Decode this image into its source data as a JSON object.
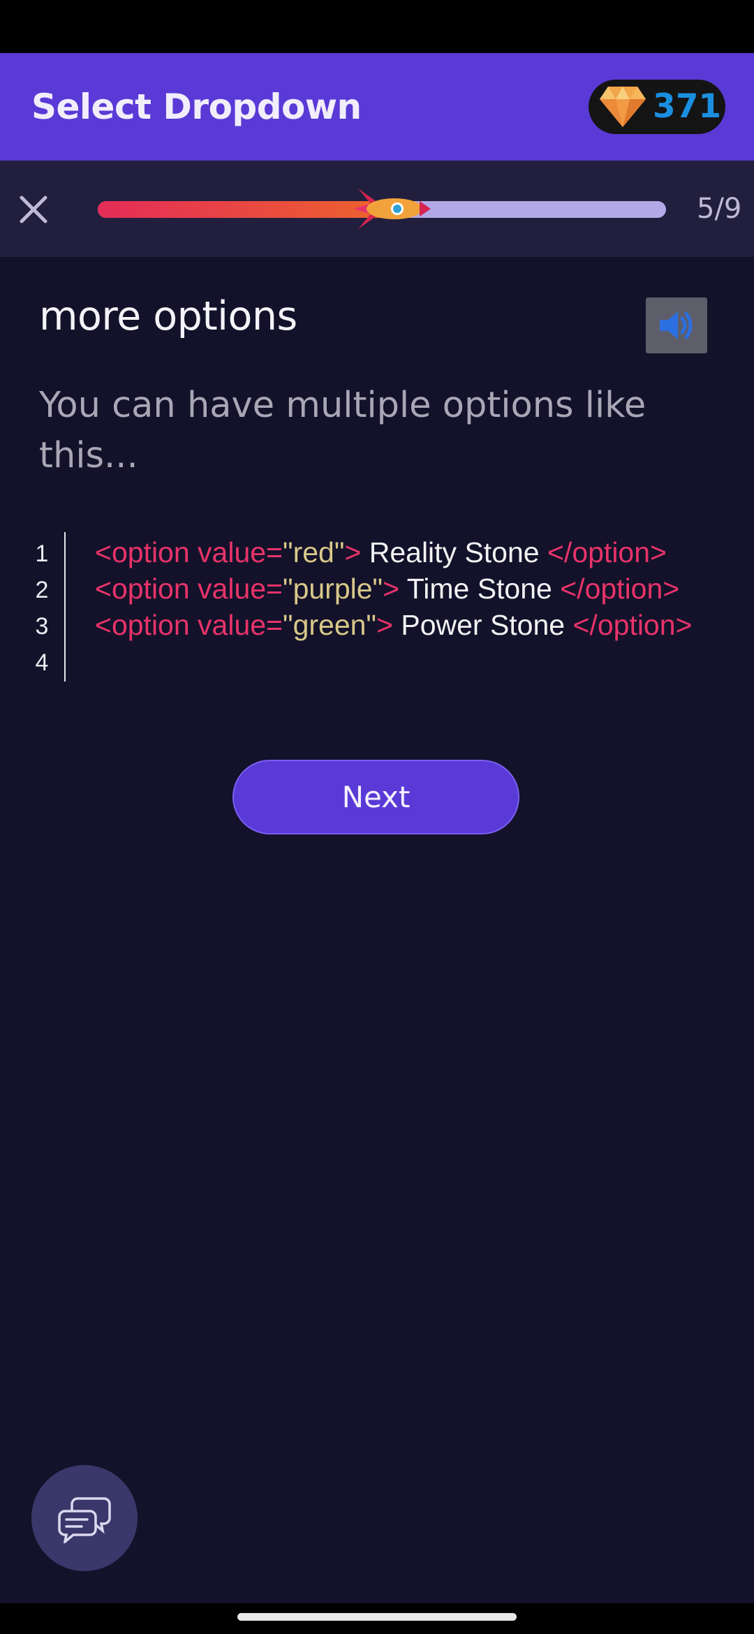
{
  "app_bar": {
    "title": "Select Dropdown",
    "gems": "371",
    "gem_icon": "diamond-icon"
  },
  "progress": {
    "close_icon": "close-icon",
    "current": 5,
    "total": 9,
    "label": "5/9",
    "fraction": 0.555,
    "colors": {
      "fill_start": "#e42c58",
      "fill_end": "#ee6a2a",
      "track": "#b2a9e6"
    }
  },
  "lesson": {
    "title": "more options",
    "sound_icon": "speaker-icon",
    "text": "You can have multiple options like this..."
  },
  "code": {
    "line_numbers": [
      "1",
      "2",
      "3",
      "4"
    ],
    "lines": [
      {
        "open": "<option value=",
        "value": "\"red\"",
        "close_bracket": ">",
        "content": " Reality Stone ",
        "end_tag": "</option>"
      },
      {
        "open": "<option value=",
        "value": "\"purple\"",
        "close_bracket": ">",
        "content": " Time Stone ",
        "end_tag": "</option>"
      },
      {
        "open": "<option value=",
        "value": "\"green\"",
        "close_bracket": ">",
        "content": " Power Stone ",
        "end_tag": "</option>"
      }
    ]
  },
  "actions": {
    "next_label": "Next",
    "chat_icon": "chat-bubbles-icon"
  },
  "colors": {
    "background": "#13122a",
    "accent": "#5a3ad6",
    "tag": "#e8336a",
    "string": "#d9c88a",
    "gem_count": "#1a8fe0"
  }
}
